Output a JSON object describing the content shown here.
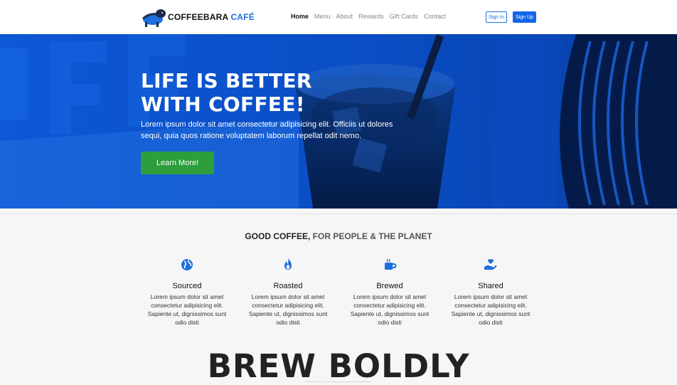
{
  "brand": {
    "name": "COFFEEBARA",
    "name_accent": "CAFÉ"
  },
  "nav": {
    "links": [
      "Home",
      "Menu",
      "About",
      "Rewards",
      "Gift Cards",
      "Contact"
    ],
    "active": "Home"
  },
  "auth": {
    "signin_label": "Sign In",
    "signup_label": "Sign Up"
  },
  "hero": {
    "title_line1": "LIFE IS BETTER",
    "title_line2": "WITH COFFEE!",
    "subtitle": "Lorem ipsum dolor sit amet consectetur adipisicing elit. Officiis ut dolores sequi, quia quos ratione voluptatem laborum repellat odit nemo.",
    "cta_label": "Learn More!"
  },
  "section": {
    "title_main": "GOOD COFFEE,",
    "title_accent": "FOR PEOPLE & THE PLANET",
    "features": [
      {
        "icon": "globe-icon",
        "title": "Sourced",
        "desc": "Lorem ipsum dolor sit amet consectetur adipisicing elit. Sapiente ut, dignissimos sunt odio disti"
      },
      {
        "icon": "flame-icon",
        "title": "Roasted",
        "desc": "Lorem ipsum dolor sit amet consectetur adipisicing elit. Sapiente ut, dignissimos sunt odio disti"
      },
      {
        "icon": "mug-icon",
        "title": "Brewed",
        "desc": "Lorem ipsum dolor sit amet consectetur adipisicing elit. Sapiente ut, dignissimos sunt odio disti"
      },
      {
        "icon": "hand-heart-icon",
        "title": "Shared",
        "desc": "Lorem ipsum dolor sit amet consectetur adipisicing elit. Sapiente ut, dignissimos sunt odio disti"
      }
    ]
  },
  "banner": {
    "text": "BREW BOLDLY"
  },
  "colors": {
    "accent": "#1d6fe0",
    "hero_overlay": "#0a46b5",
    "cta_green": "#2c9e3b"
  }
}
